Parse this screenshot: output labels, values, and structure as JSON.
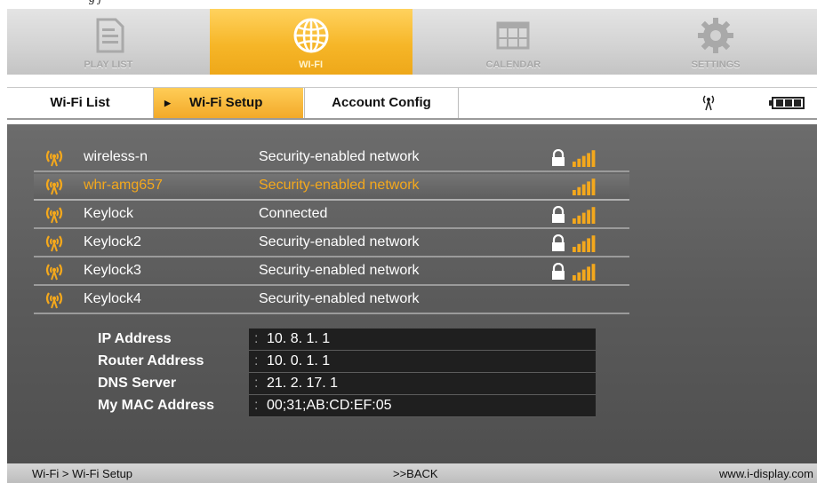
{
  "top_caption": "g                   j",
  "nav": {
    "items": [
      {
        "label": "PLAY LIST",
        "icon": "document-icon",
        "active": false
      },
      {
        "label": "WI-FI",
        "icon": "globe-icon",
        "active": true
      },
      {
        "label": "CALENDAR",
        "icon": "calendar-icon",
        "active": false
      },
      {
        "label": "SETTINGS",
        "icon": "gear-icon",
        "active": false
      }
    ]
  },
  "tabs": {
    "wifi_list": "Wi-Fi List",
    "wifi_setup": "Wi-Fi Setup",
    "account_config": "Account Config"
  },
  "networks": [
    {
      "name": "wireless-n",
      "status": "Security-enabled network",
      "locked": true,
      "signal": true,
      "selected": false
    },
    {
      "name": "whr-amg657",
      "status": "Security-enabled network",
      "locked": false,
      "signal": true,
      "selected": true
    },
    {
      "name": "Keylock",
      "status": "Connected",
      "locked": true,
      "signal": true,
      "selected": false
    },
    {
      "name": "Keylock2",
      "status": "Security-enabled network",
      "locked": true,
      "signal": true,
      "selected": false
    },
    {
      "name": "Keylock3",
      "status": "Security-enabled network",
      "locked": true,
      "signal": true,
      "selected": false
    },
    {
      "name": "Keylock4",
      "status": "Security-enabled network",
      "locked": false,
      "signal": false,
      "selected": false
    }
  ],
  "info": [
    {
      "label": "IP Address",
      "value": "10. 8. 1. 1"
    },
    {
      "label": "Router Address",
      "value": "10. 0. 1. 1"
    },
    {
      "label": "DNS Server",
      "value": "21. 2. 17. 1"
    },
    {
      "label": "My MAC Address",
      "value": "00;31;AB:CD:EF:05"
    }
  ],
  "separator": ":",
  "statusbar": {
    "breadcrumb": "Wi-Fi > Wi-Fi Setup",
    "back": ">>BACK",
    "website": "www.i-display.com"
  },
  "colors": {
    "accent": "#f4a81c",
    "panel": "#5b5b5b",
    "value_bg": "#1f1f1f"
  }
}
